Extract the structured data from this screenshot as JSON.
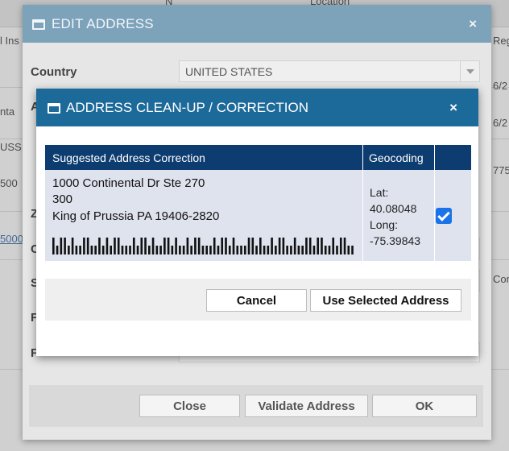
{
  "background": {
    "header_fragments": [
      "N",
      "Location"
    ],
    "left_fragments": [
      "l Ins",
      "nta",
      "USSI",
      "500",
      "5000"
    ],
    "right_fragments": [
      "Reg",
      "6/2",
      "6/2",
      "775",
      "Cor"
    ]
  },
  "edit_dialog": {
    "title": "EDIT ADDRESS",
    "close_glyph": "×",
    "icon": "window-icon",
    "country_label": "Country",
    "country_value": "UNITED STATES",
    "partial_labels": [
      "A",
      "Z",
      "C",
      "S",
      "F",
      "F"
    ],
    "buttons": {
      "close": "Close",
      "validate": "Validate Address",
      "ok": "OK"
    }
  },
  "cleanup_dialog": {
    "title": "ADDRESS CLEAN-UP / CORRECTION",
    "close_glyph": "×",
    "icon": "window-icon",
    "table": {
      "headers": {
        "suggested": "Suggested Address Correction",
        "geocoding": "Geocoding"
      },
      "row": {
        "address_lines": [
          "1000 Continental Dr Ste 270",
          "300",
          "King of Prussia PA 19406-2820"
        ],
        "geocoding_lines": [
          "Lat:",
          "40.08048",
          "Long:",
          "-75.39843"
        ],
        "selected": true
      }
    },
    "buttons": {
      "cancel": "Cancel",
      "use_selected": "Use Selected Address"
    }
  },
  "colors": {
    "cleanup_title_bar": "#1c6a9a",
    "table_header": "#0d3d70",
    "edit_title_bar": "#7da3bb",
    "checkbox": "#1a73e8"
  }
}
